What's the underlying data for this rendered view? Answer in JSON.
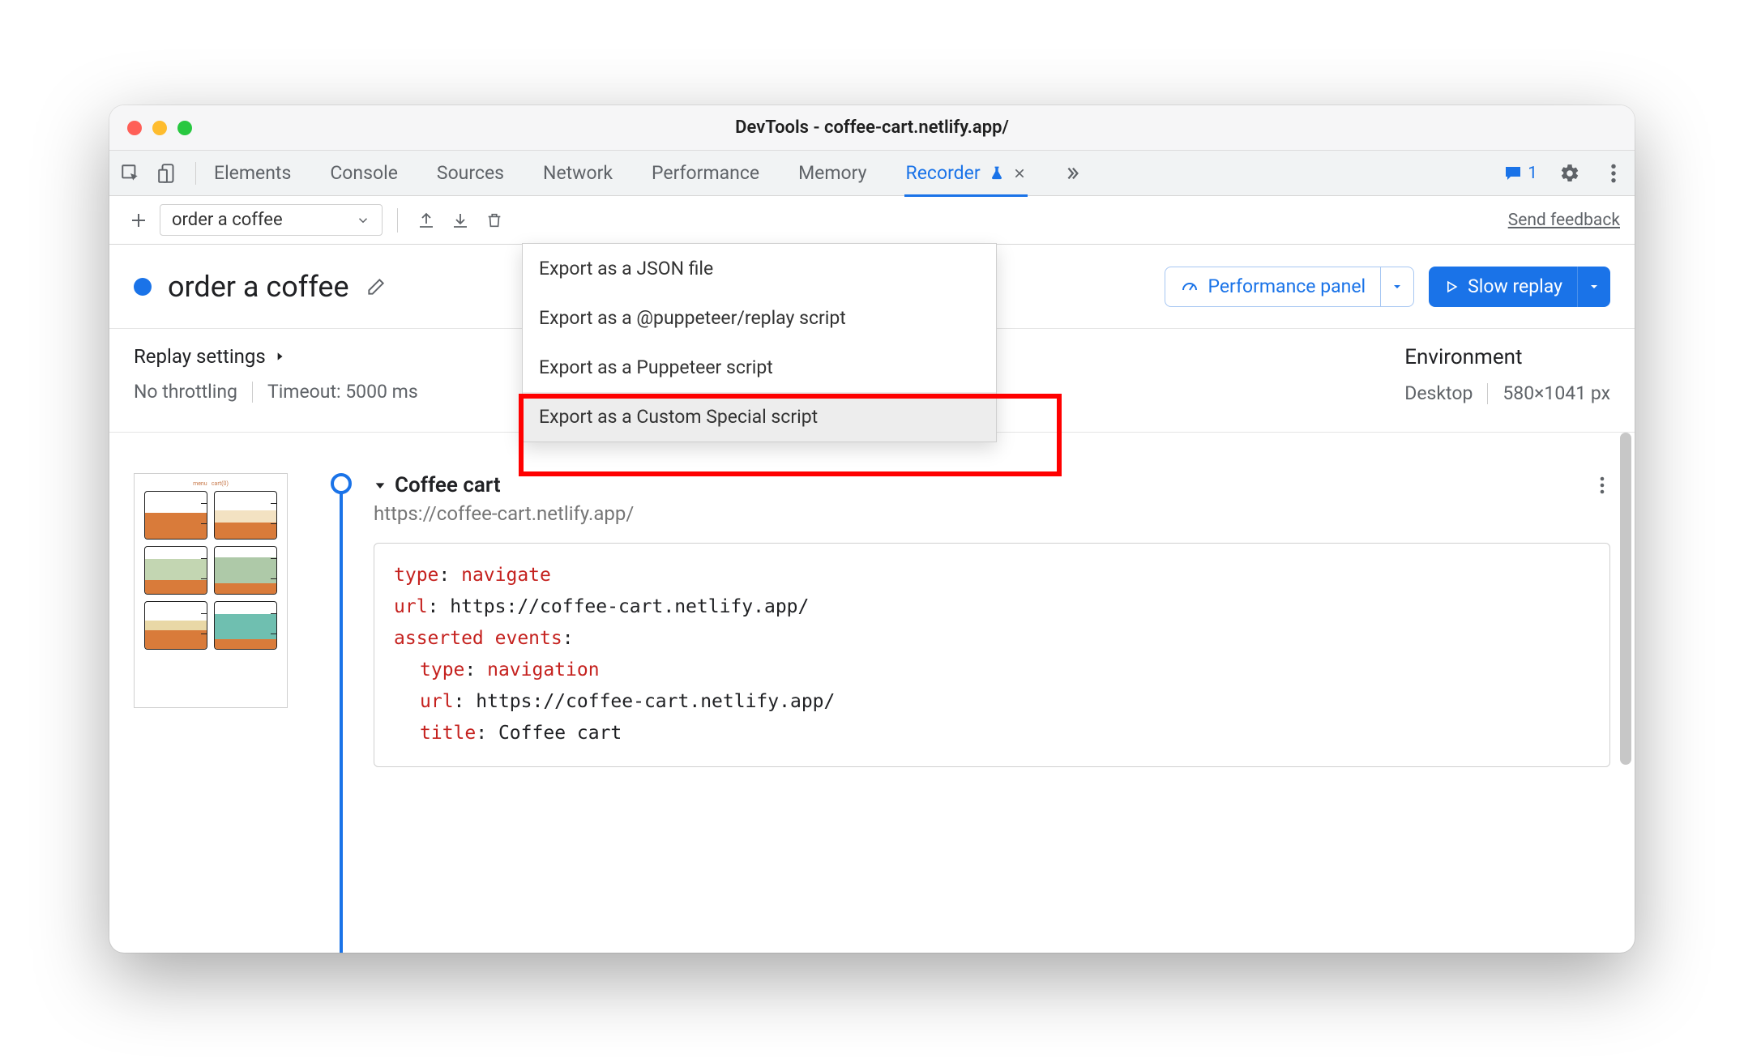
{
  "window": {
    "title": "DevTools - coffee-cart.netlify.app/"
  },
  "tabs": {
    "items": [
      "Elements",
      "Console",
      "Sources",
      "Network",
      "Performance",
      "Memory",
      "Recorder"
    ],
    "active": "Recorder",
    "issues_count": "1"
  },
  "toolbar": {
    "recording_name": "order a coffee",
    "feedback": "Send feedback"
  },
  "export_menu": {
    "items": [
      "Export as a JSON file",
      "Export as a @puppeteer/replay script",
      "Export as a Puppeteer script",
      "Export as a Custom Special script"
    ],
    "hover_index": 3
  },
  "header": {
    "title": "order a coffee",
    "perf_btn": "Performance panel",
    "replay_btn": "Slow replay"
  },
  "settings": {
    "label": "Replay settings",
    "throttling": "No throttling",
    "timeout": "Timeout: 5000 ms",
    "env_label": "Environment",
    "env_device": "Desktop",
    "env_size": "580×1041 px"
  },
  "step": {
    "title": "Coffee cart",
    "url": "https://coffee-cart.netlify.app/",
    "code": {
      "type_k": "type",
      "type_v": "navigate",
      "url_k": "url",
      "url_v": "https://coffee-cart.netlify.app/",
      "asserted_k": "asserted events",
      "nav_type_k": "type",
      "nav_type_v": "navigation",
      "nav_url_k": "url",
      "nav_url_v": "https://coffee-cart.netlify.app/",
      "title_k": "title",
      "title_v": "Coffee cart"
    }
  }
}
